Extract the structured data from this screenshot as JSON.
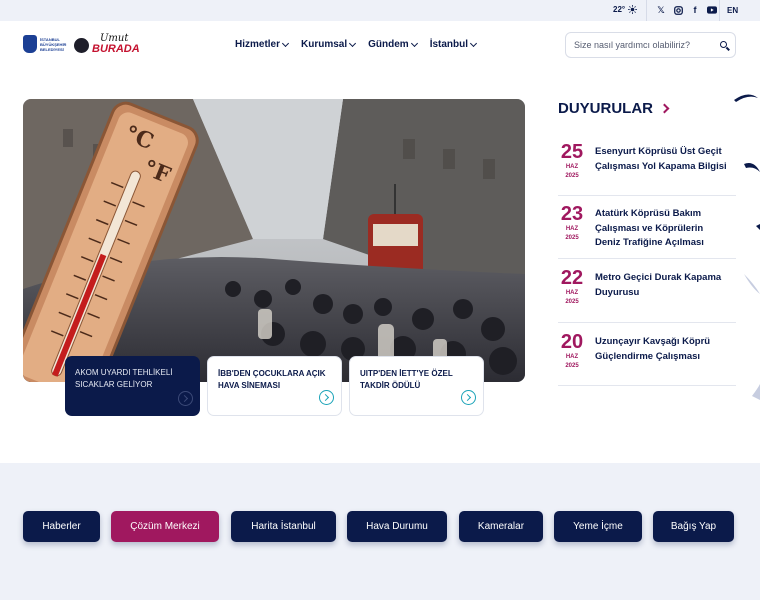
{
  "topbar": {
    "temperature": "22°",
    "weather_icon": "sun-icon",
    "socials": [
      "x-icon",
      "instagram-icon",
      "facebook-icon",
      "youtube-icon"
    ],
    "language": "EN"
  },
  "header": {
    "logo_ibb_text": "İSTANBUL BÜYÜKŞEHİR BELEDİYESİ",
    "logo_burada_line1": "Umut",
    "logo_burada_line2": "BURADA",
    "nav": [
      "Hizmetler",
      "Kurumsal",
      "Gündem",
      "İstanbul"
    ],
    "search_placeholder": "Size nasıl yardımcı olabiliriz?"
  },
  "hero": {
    "cards": [
      {
        "title": "AKOM UYARDI TEHLİKELİ SICAKLAR GELİYOR"
      },
      {
        "title": "İBB'DEN ÇOCUKLARA AÇIK HAVA SİNEMASI"
      },
      {
        "title": "UITP'DEN İETT'YE ÖZEL TAKDİR ÖDÜLÜ"
      }
    ]
  },
  "announcements": {
    "title": "DUYURULAR",
    "items": [
      {
        "day": "25",
        "month": "HAZ",
        "year": "2025",
        "text": "Esenyurt Köprüsü Üst Geçit Çalışması Yol Kapama Bilgisi"
      },
      {
        "day": "23",
        "month": "HAZ",
        "year": "2025",
        "text": "Atatürk Köprüsü Bakım Çalışması ve Köprülerin Deniz Trafiğine Açılması"
      },
      {
        "day": "22",
        "month": "HAZ",
        "year": "2025",
        "text": "Metro Geçici Durak Kapama Duyurusu"
      },
      {
        "day": "20",
        "month": "HAZ",
        "year": "2025",
        "text": "Uzunçayır Kavşağı Köprü Güçlendirme Çalışması"
      }
    ]
  },
  "quick_links": [
    "Haberler",
    "Çözüm Merkezi",
    "Harita İstanbul",
    "Hava Durumu",
    "Kameralar",
    "Yeme İçme",
    "Bağış Yap"
  ],
  "colors": {
    "navy": "#0b1a4a",
    "accent": "#a0185f",
    "teal": "#1aa3b8",
    "band": "#eef1f8"
  }
}
